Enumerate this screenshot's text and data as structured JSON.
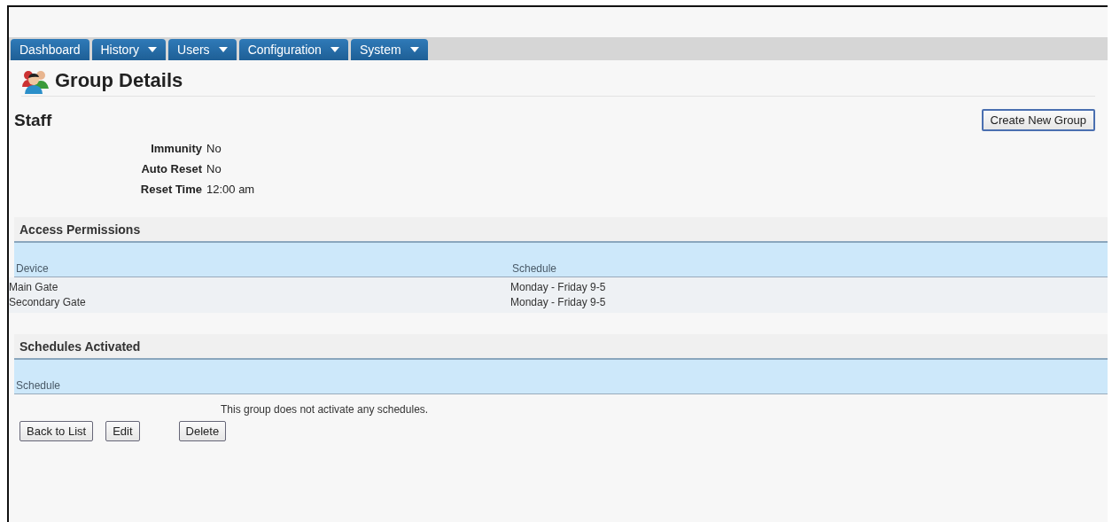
{
  "nav_tabs": [
    {
      "label": "Dashboard",
      "dropdown": false
    },
    {
      "label": "History",
      "dropdown": true
    },
    {
      "label": "Users",
      "dropdown": true
    },
    {
      "label": "Configuration",
      "dropdown": true
    },
    {
      "label": "System",
      "dropdown": true
    }
  ],
  "page_title": "Group Details",
  "group_name": "Staff",
  "create_button": "Create New Group",
  "fields": [
    {
      "label": "Immunity",
      "value": "No"
    },
    {
      "label": "Auto Reset",
      "value": "No"
    },
    {
      "label": "Reset Time",
      "value": "12:00 am"
    }
  ],
  "access_permissions": {
    "title": "Access Permissions",
    "columns": [
      "Device",
      "Schedule"
    ],
    "rows": [
      [
        "Main Gate",
        "Monday - Friday 9-5"
      ],
      [
        "Secondary Gate",
        "Monday - Friday 9-5"
      ]
    ]
  },
  "schedules_activated": {
    "title": "Schedules Activated",
    "columns": [
      "Schedule"
    ],
    "empty_message": "This group does not activate any schedules."
  },
  "buttons": [
    "Back to List",
    "Edit",
    "Delete"
  ]
}
